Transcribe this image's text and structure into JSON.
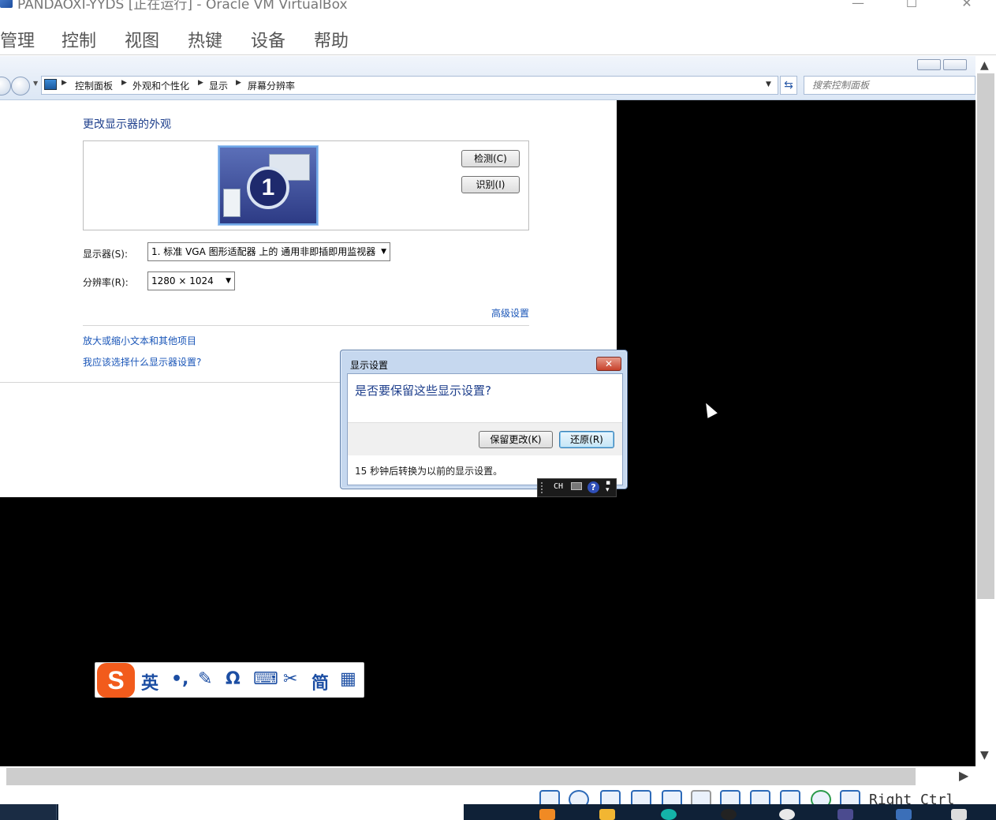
{
  "host": {
    "window_title": "PANDAOXI-YYDS [正在运行] - Oracle VM VirtualBox",
    "menu": [
      "管理",
      "控制",
      "视图",
      "热键",
      "设备",
      "帮助"
    ],
    "right_ctrl": "Right Ctrl"
  },
  "explorer": {
    "breadcrumbs": [
      "控制面板",
      "外观和个性化",
      "显示",
      "屏幕分辨率"
    ],
    "search_placeholder": "搜索控制面板"
  },
  "display_page": {
    "heading": "更改显示器的外观",
    "monitor_number": "1",
    "detect_button": "检测(C)",
    "identify_button": "识别(I)",
    "display_label": "显示器(S):",
    "display_value": "1. 标准 VGA 图形适配器 上的 通用非即插即用监视器",
    "resolution_label": "分辨率(R):",
    "resolution_value": "1280 × 1024",
    "advanced_link": "高级设置",
    "links": [
      "放大或缩小文本和其他项目",
      "我应该选择什么显示器设置?"
    ]
  },
  "dialog": {
    "title": "显示设置",
    "question": "是否要保留这些显示设置?",
    "keep_button": "保留更改(K)",
    "revert_button": "还原(R)",
    "countdown_text": "15 秒钟后转换为以前的显示设置。"
  },
  "language_bar": {
    "lang": "CH",
    "icons": [
      "keyboard-icon",
      "help-icon",
      "options-icon"
    ]
  },
  "ime_bar": {
    "logo": "S",
    "mode": "英",
    "punct": "•,",
    "icons": [
      "pen-icon",
      "omega-icon",
      "keyboard-icon",
      "scissors-icon",
      "grid-icon"
    ],
    "charset": "简"
  },
  "colors": {
    "link": "#1a56b8",
    "heading": "#1e3f8c",
    "guest_bg": "#000000",
    "ime_logo": "#f25b1c"
  }
}
